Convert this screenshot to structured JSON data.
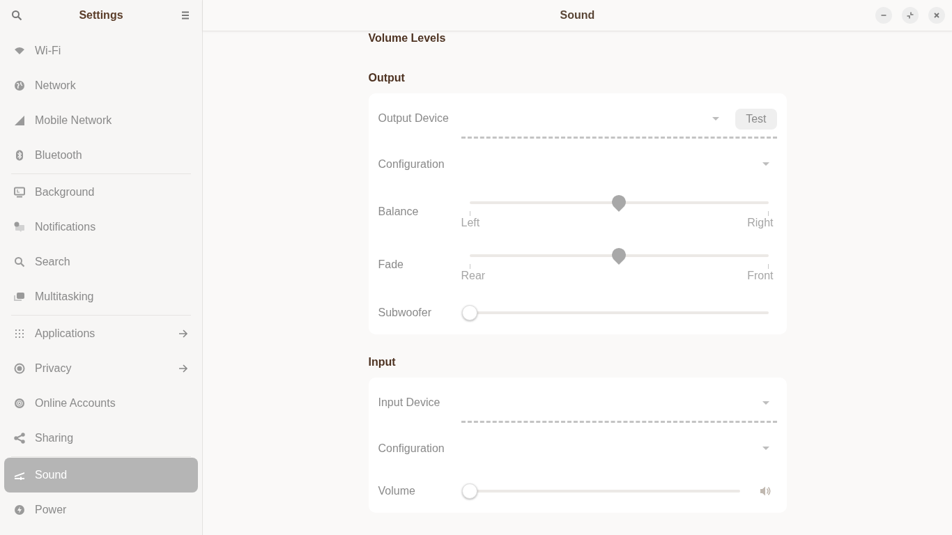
{
  "sidebar": {
    "title": "Settings",
    "groups": [
      [
        {
          "label": "Wi-Fi",
          "selected": false,
          "has_submenu": false
        },
        {
          "label": "Network",
          "selected": false,
          "has_submenu": false
        },
        {
          "label": "Mobile Network",
          "selected": false,
          "has_submenu": false
        },
        {
          "label": "Bluetooth",
          "selected": false,
          "has_submenu": false
        }
      ],
      [
        {
          "label": "Background",
          "selected": false,
          "has_submenu": false
        },
        {
          "label": "Notifications",
          "selected": false,
          "has_submenu": false
        },
        {
          "label": "Search",
          "selected": false,
          "has_submenu": false
        },
        {
          "label": "Multitasking",
          "selected": false,
          "has_submenu": false
        }
      ],
      [
        {
          "label": "Applications",
          "selected": false,
          "has_submenu": true
        },
        {
          "label": "Privacy",
          "selected": false,
          "has_submenu": true
        },
        {
          "label": "Online Accounts",
          "selected": false,
          "has_submenu": false
        },
        {
          "label": "Sharing",
          "selected": false,
          "has_submenu": false
        }
      ],
      [
        {
          "label": "Sound",
          "selected": true,
          "has_submenu": false
        },
        {
          "label": "Power",
          "selected": false,
          "has_submenu": false
        }
      ]
    ]
  },
  "window": {
    "title": "Sound"
  },
  "page_heading": "Volume Levels",
  "sections": [
    {
      "heading": "Output",
      "rows": [
        {
          "kind": "device",
          "label": "Output Device",
          "button": "Test"
        },
        {
          "kind": "select",
          "label": "Configuration"
        },
        {
          "kind": "marked_slider",
          "label": "Balance",
          "level": 0.5,
          "start_label": "Left",
          "end_label": "Right"
        },
        {
          "kind": "marked_slider",
          "label": "Fade",
          "level": 0.5,
          "start_label": "Rear",
          "end_label": "Front"
        },
        {
          "kind": "slider",
          "label": "Subwoofer",
          "level": 0
        }
      ]
    },
    {
      "heading": "Input",
      "rows": [
        {
          "kind": "device",
          "label": "Input Device"
        },
        {
          "kind": "select",
          "label": "Configuration"
        },
        {
          "kind": "volume_slider",
          "label": "Volume",
          "level": 0
        }
      ]
    }
  ]
}
